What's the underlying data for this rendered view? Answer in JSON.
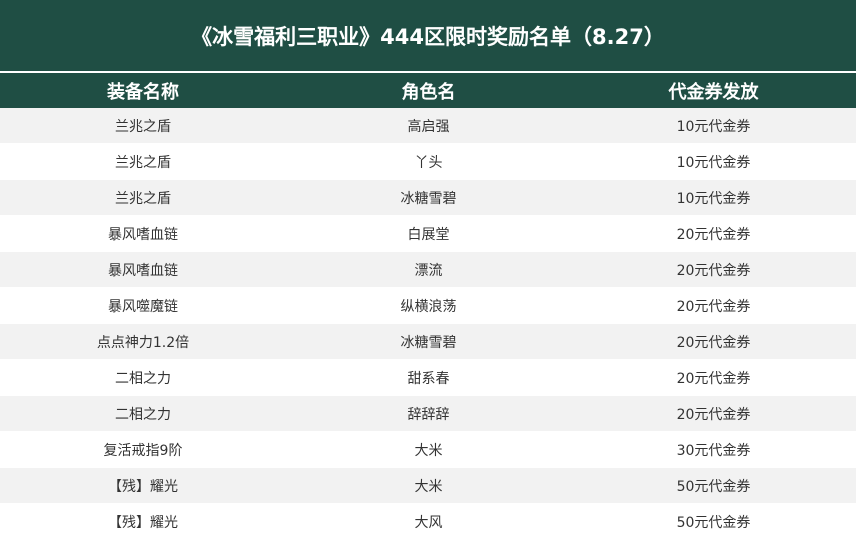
{
  "title": "《冰雪福利三职业》444区限时奖励名单（8.27）",
  "columns": [
    "装备名称",
    "角色名",
    "代金券发放"
  ],
  "rows": [
    [
      "兰兆之盾",
      "高启强",
      "10元代金券"
    ],
    [
      "兰兆之盾",
      "丫头",
      "10元代金券"
    ],
    [
      "兰兆之盾",
      "冰糖雪碧",
      "10元代金券"
    ],
    [
      "暴风嗜血链",
      "白展堂",
      "20元代金券"
    ],
    [
      "暴风嗜血链",
      "漂流",
      "20元代金券"
    ],
    [
      "暴风噬魔链",
      "纵横浪荡",
      "20元代金券"
    ],
    [
      "点点神力1.2倍",
      "冰糖雪碧",
      "20元代金券"
    ],
    [
      "二相之力",
      "甜系春",
      "20元代金券"
    ],
    [
      "二相之力",
      "辞辞辞",
      "20元代金券"
    ],
    [
      "复活戒指9阶",
      "大米",
      "30元代金券"
    ],
    [
      "【残】耀光",
      "大米",
      "50元代金券"
    ],
    [
      "【残】耀光",
      "大风",
      "50元代金券"
    ]
  ],
  "colors": {
    "header_bg": "#1f4e44",
    "row_alt": "#f2f2f2"
  }
}
